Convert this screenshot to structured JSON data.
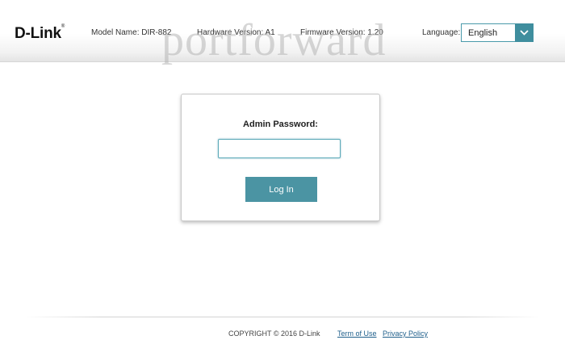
{
  "header": {
    "logo": "D-Link",
    "logo_mark": "®",
    "model_name": "Model Name: DIR-882",
    "hardware_version": "Hardware Version: A1",
    "firmware_version": "Firmware Version: 1.20",
    "language_label": "Language:",
    "language_value": "English",
    "watermark": "portforward"
  },
  "login": {
    "password_label": "Admin Password:",
    "password_value": "",
    "login_button": "Log In"
  },
  "footer": {
    "copyright": "COPYRIGHT © 2016 D-Link",
    "term_of_use": "Term of Use",
    "privacy_policy": "Privacy Policy"
  },
  "colors": {
    "accent": "#4b94a3",
    "dropdown_arrow_bg": "#3f8e9e",
    "link": "#1f5f8b"
  },
  "icons": {
    "dropdown": "chevron-down-icon"
  }
}
